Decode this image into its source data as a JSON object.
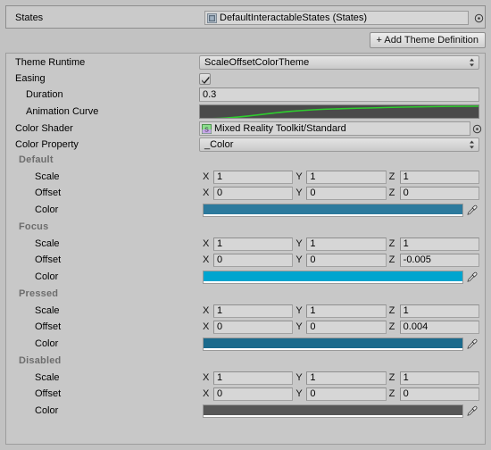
{
  "panel": {
    "states_row": {
      "label": "States",
      "object_value": "DefaultInteractableStates (States)",
      "object_icon": "scriptable-object-icon",
      "target_picker_icon": "object-picker-icon"
    },
    "add_theme_button": {
      "label": "+ Add Theme Definition"
    },
    "properties": [
      {
        "name": "theme-runtime",
        "label": "Theme Runtime",
        "control": "popup",
        "value": "ScaleOffsetColorTheme"
      },
      {
        "name": "easing",
        "label": "Easing",
        "control": "checkbox",
        "value": "checked"
      },
      {
        "name": "duration",
        "label": "Duration",
        "control": "textfield",
        "indent": true,
        "value": "0.3"
      },
      {
        "name": "animation-curve",
        "label": "Animation Curve",
        "control": "curve",
        "indent": true,
        "value": "ease-out",
        "curve_color": "#2ecc2e",
        "curve_background": "#4a4a4a"
      },
      {
        "name": "color-shader",
        "label": "Color Shader",
        "control": "objectfield",
        "value": "Mixed Reality Toolkit/Standard",
        "object_icon": "shader-icon",
        "target_picker_icon": "object-picker-icon"
      },
      {
        "name": "color-property",
        "label": "Color Property",
        "control": "popup",
        "value": "_Color"
      }
    ],
    "state_sections": [
      {
        "name": "default",
        "title": "Default",
        "scale": {
          "label": "Scale",
          "x": "1",
          "y": "1",
          "z": "1"
        },
        "offset": {
          "label": "Offset",
          "x": "0",
          "y": "0",
          "z": "0"
        },
        "color": {
          "label": "Color",
          "hex": "#2c7a9d"
        }
      },
      {
        "name": "focus",
        "title": "Focus",
        "scale": {
          "label": "Scale",
          "x": "1",
          "y": "1",
          "z": "1"
        },
        "offset": {
          "label": "Offset",
          "x": "0",
          "y": "0",
          "z": "-0.005"
        },
        "color": {
          "label": "Color",
          "hex": "#00a5cf"
        }
      },
      {
        "name": "pressed",
        "title": "Pressed",
        "scale": {
          "label": "Scale",
          "x": "1",
          "y": "1",
          "z": "1"
        },
        "offset": {
          "label": "Offset",
          "x": "0",
          "y": "0",
          "z": "0.004"
        },
        "color": {
          "label": "Color",
          "hex": "#1b6a8c"
        }
      },
      {
        "name": "disabled",
        "title": "Disabled",
        "scale": {
          "label": "Scale",
          "x": "1",
          "y": "1",
          "z": "1"
        },
        "offset": {
          "label": "Offset",
          "x": "0",
          "y": "0",
          "z": "0"
        },
        "color": {
          "label": "Color",
          "hex": "#575757"
        }
      }
    ],
    "axis_labels": {
      "x": "X",
      "y": "Y",
      "z": "Z"
    },
    "theme": {
      "window_background": "#c2c2c2",
      "panel_background": "#c8c8c8",
      "field_background": "#d6d6d6",
      "section_header_color": "#6d6d6d",
      "border_color": "#9a9a9a"
    }
  }
}
